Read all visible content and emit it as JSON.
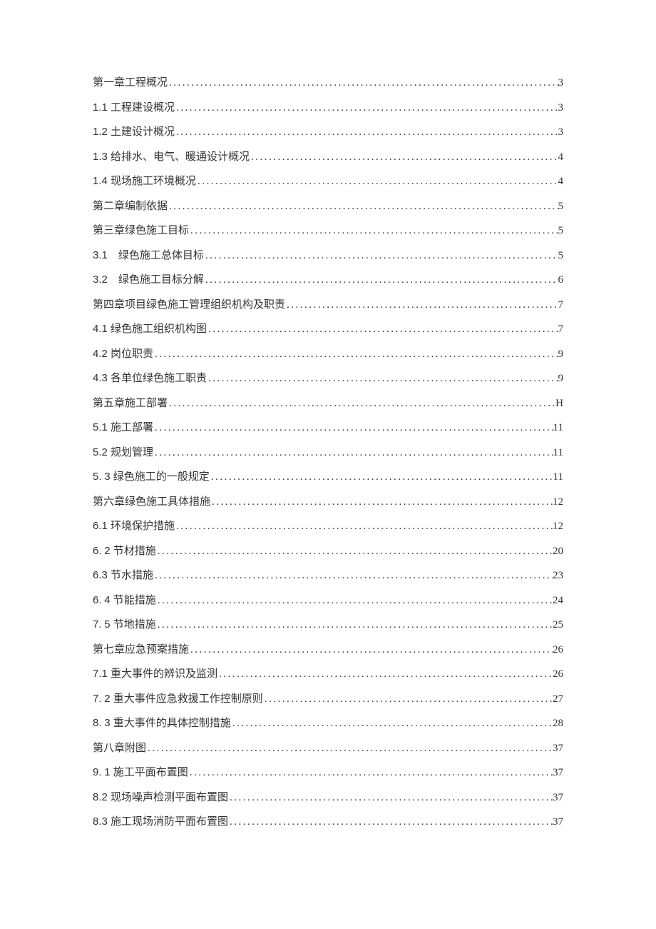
{
  "toc": [
    {
      "title": "第一章工程概况",
      "page": "3"
    },
    {
      "title": "1.1 工程建设概况",
      "page": "3"
    },
    {
      "title": "1.2 土建设计概况",
      "page": "3"
    },
    {
      "title": "1.3 给排水、电气、暖通设计概况",
      "page": "4"
    },
    {
      "title": "1.4 现场施工环境概况",
      "page": "4"
    },
    {
      "title": "第二章编制依据",
      "page": "5"
    },
    {
      "title": "第三章绿色施工目标",
      "page": "5"
    },
    {
      "title": "3.1 绿色施工总体目标",
      "page": "5"
    },
    {
      "title": "3.2 绿色施工目标分解",
      "page": "6"
    },
    {
      "title": "第四章项目绿色施工管理组织机构及职责",
      "page": "7"
    },
    {
      "title": "4.1 绿色施工组织机构图",
      "page": "7"
    },
    {
      "title": "4.2 岗位职责",
      "page": "9"
    },
    {
      "title": "4.3 各单位绿色施工职责",
      "page": "9"
    },
    {
      "title": "第五章施工部署",
      "page": "H"
    },
    {
      "title": "5.1 施工部署",
      "page": "11"
    },
    {
      "title": "5.2 规划管理",
      "page": "11"
    },
    {
      "title": "5. 3 绿色施工的一般规定",
      "page": "11"
    },
    {
      "title": "第六章绿色施工具体措施",
      "page": "12"
    },
    {
      "title": "6.1 环境保护措施",
      "page": "12"
    },
    {
      "title": "6. 2 节材措施",
      "page": "20"
    },
    {
      "title": "6.3 节水措施",
      "page": "23"
    },
    {
      "title": "6. 4 节能措施",
      "page": "24"
    },
    {
      "title": "7. 5 节地措施",
      "page": "25"
    },
    {
      "title": "第七章应急预案措施",
      "page": "26"
    },
    {
      "title": "7.1 重大事件的辨识及监测",
      "page": "26"
    },
    {
      "title": "7. 2 重大事件应急救援工作控制原则",
      "page": "27"
    },
    {
      "title": "8. 3 重大事件的具体控制措施",
      "page": "28"
    },
    {
      "title": "第八章附图",
      "page": "37"
    },
    {
      "title": "9. 1 施工平面布置图",
      "page": "37"
    },
    {
      "title": "8.2 现场噪声检测平面布置图",
      "page": "37"
    },
    {
      "title": "8.3 施工现场消防平面布置图",
      "page": "37"
    }
  ]
}
